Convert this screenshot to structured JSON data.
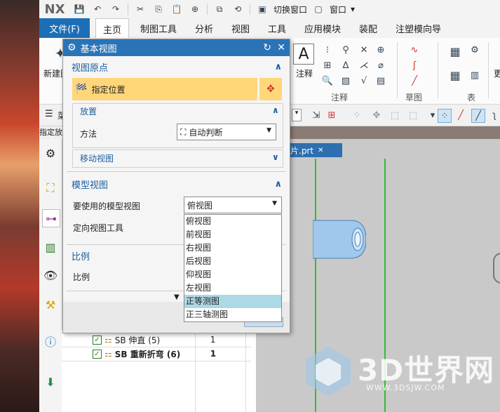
{
  "app": {
    "logo": "NX"
  },
  "quick_toolbar": {
    "switch_window": "切换窗口",
    "window": "窗口"
  },
  "menu": {
    "file": "文件(F)",
    "tabs": [
      "主页",
      "制图工具",
      "分析",
      "视图",
      "工具",
      "应用模块",
      "装配",
      "注塑模向导"
    ]
  },
  "ribbon": {
    "new_label": "新建图",
    "note_label": "注释",
    "group_annotation": "注释",
    "group_sketch": "草图",
    "group_table": "表",
    "overflow_label": "更"
  },
  "toolbar2": {
    "first_item": "菜"
  },
  "left_panel_label": "指定放",
  "drawing": {
    "tab_label": "片.prt"
  },
  "dialog": {
    "title": "基本视图",
    "group_origin": "视图原点",
    "specify_location": "指定位置",
    "placement_group": "放置",
    "method_label": "方法",
    "method_value": "自动判断",
    "move_view_group": "移动视图",
    "group_model_view": "模型视图",
    "model_view_label": "要使用的模型视图",
    "model_view_value": "俯视图",
    "orient_tool_label": "定向视图工具",
    "group_scale": "比例",
    "scale_label": "比例",
    "dropdown_options": [
      "俯视图",
      "前视图",
      "右视图",
      "后视图",
      "仰视图",
      "左视图",
      "正等测图",
      "正三轴测图"
    ],
    "highlighted_option": "正等测图"
  },
  "navigator": {
    "rows": [
      {
        "label": "SB 伸直 (5)",
        "value": "1",
        "bold": false
      },
      {
        "label": "SB 重新折弯 (6)",
        "value": "1",
        "bold": true
      }
    ]
  },
  "watermark": {
    "text": "3D世界网",
    "url": "WWW.3DSJW.COM"
  },
  "colors": {
    "accent": "#2b73b7",
    "file_tab": "#1c6fb6",
    "group_header": "#1c5fa0",
    "highlight_row": "#ffd77a",
    "dropdown_selected": "#add8e6",
    "guide_line": "#2fbf2f"
  }
}
